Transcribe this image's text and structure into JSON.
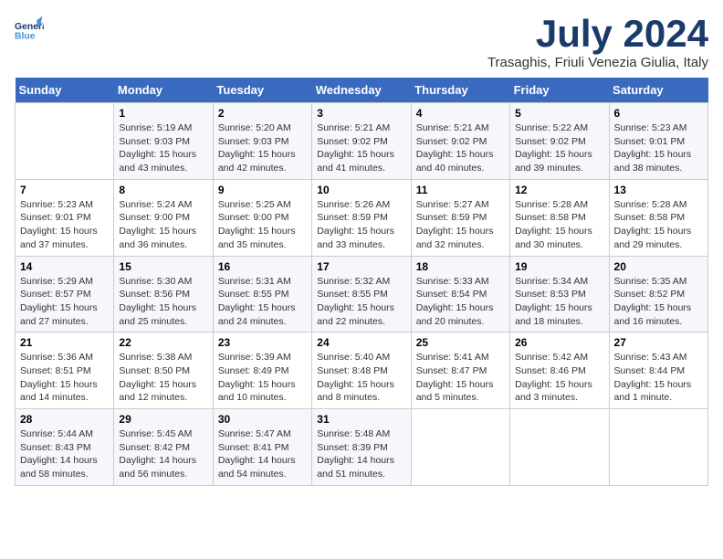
{
  "header": {
    "logo_line1": "General",
    "logo_line2": "Blue",
    "month": "July 2024",
    "location": "Trasaghis, Friuli Venezia Giulia, Italy"
  },
  "days_of_week": [
    "Sunday",
    "Monday",
    "Tuesday",
    "Wednesday",
    "Thursday",
    "Friday",
    "Saturday"
  ],
  "weeks": [
    [
      {
        "day": "",
        "info": ""
      },
      {
        "day": "1",
        "info": "Sunrise: 5:19 AM\nSunset: 9:03 PM\nDaylight: 15 hours\nand 43 minutes."
      },
      {
        "day": "2",
        "info": "Sunrise: 5:20 AM\nSunset: 9:03 PM\nDaylight: 15 hours\nand 42 minutes."
      },
      {
        "day": "3",
        "info": "Sunrise: 5:21 AM\nSunset: 9:02 PM\nDaylight: 15 hours\nand 41 minutes."
      },
      {
        "day": "4",
        "info": "Sunrise: 5:21 AM\nSunset: 9:02 PM\nDaylight: 15 hours\nand 40 minutes."
      },
      {
        "day": "5",
        "info": "Sunrise: 5:22 AM\nSunset: 9:02 PM\nDaylight: 15 hours\nand 39 minutes."
      },
      {
        "day": "6",
        "info": "Sunrise: 5:23 AM\nSunset: 9:01 PM\nDaylight: 15 hours\nand 38 minutes."
      }
    ],
    [
      {
        "day": "7",
        "info": "Sunrise: 5:23 AM\nSunset: 9:01 PM\nDaylight: 15 hours\nand 37 minutes."
      },
      {
        "day": "8",
        "info": "Sunrise: 5:24 AM\nSunset: 9:00 PM\nDaylight: 15 hours\nand 36 minutes."
      },
      {
        "day": "9",
        "info": "Sunrise: 5:25 AM\nSunset: 9:00 PM\nDaylight: 15 hours\nand 35 minutes."
      },
      {
        "day": "10",
        "info": "Sunrise: 5:26 AM\nSunset: 8:59 PM\nDaylight: 15 hours\nand 33 minutes."
      },
      {
        "day": "11",
        "info": "Sunrise: 5:27 AM\nSunset: 8:59 PM\nDaylight: 15 hours\nand 32 minutes."
      },
      {
        "day": "12",
        "info": "Sunrise: 5:28 AM\nSunset: 8:58 PM\nDaylight: 15 hours\nand 30 minutes."
      },
      {
        "day": "13",
        "info": "Sunrise: 5:28 AM\nSunset: 8:58 PM\nDaylight: 15 hours\nand 29 minutes."
      }
    ],
    [
      {
        "day": "14",
        "info": "Sunrise: 5:29 AM\nSunset: 8:57 PM\nDaylight: 15 hours\nand 27 minutes."
      },
      {
        "day": "15",
        "info": "Sunrise: 5:30 AM\nSunset: 8:56 PM\nDaylight: 15 hours\nand 25 minutes."
      },
      {
        "day": "16",
        "info": "Sunrise: 5:31 AM\nSunset: 8:55 PM\nDaylight: 15 hours\nand 24 minutes."
      },
      {
        "day": "17",
        "info": "Sunrise: 5:32 AM\nSunset: 8:55 PM\nDaylight: 15 hours\nand 22 minutes."
      },
      {
        "day": "18",
        "info": "Sunrise: 5:33 AM\nSunset: 8:54 PM\nDaylight: 15 hours\nand 20 minutes."
      },
      {
        "day": "19",
        "info": "Sunrise: 5:34 AM\nSunset: 8:53 PM\nDaylight: 15 hours\nand 18 minutes."
      },
      {
        "day": "20",
        "info": "Sunrise: 5:35 AM\nSunset: 8:52 PM\nDaylight: 15 hours\nand 16 minutes."
      }
    ],
    [
      {
        "day": "21",
        "info": "Sunrise: 5:36 AM\nSunset: 8:51 PM\nDaylight: 15 hours\nand 14 minutes."
      },
      {
        "day": "22",
        "info": "Sunrise: 5:38 AM\nSunset: 8:50 PM\nDaylight: 15 hours\nand 12 minutes."
      },
      {
        "day": "23",
        "info": "Sunrise: 5:39 AM\nSunset: 8:49 PM\nDaylight: 15 hours\nand 10 minutes."
      },
      {
        "day": "24",
        "info": "Sunrise: 5:40 AM\nSunset: 8:48 PM\nDaylight: 15 hours\nand 8 minutes."
      },
      {
        "day": "25",
        "info": "Sunrise: 5:41 AM\nSunset: 8:47 PM\nDaylight: 15 hours\nand 5 minutes."
      },
      {
        "day": "26",
        "info": "Sunrise: 5:42 AM\nSunset: 8:46 PM\nDaylight: 15 hours\nand 3 minutes."
      },
      {
        "day": "27",
        "info": "Sunrise: 5:43 AM\nSunset: 8:44 PM\nDaylight: 15 hours\nand 1 minute."
      }
    ],
    [
      {
        "day": "28",
        "info": "Sunrise: 5:44 AM\nSunset: 8:43 PM\nDaylight: 14 hours\nand 58 minutes."
      },
      {
        "day": "29",
        "info": "Sunrise: 5:45 AM\nSunset: 8:42 PM\nDaylight: 14 hours\nand 56 minutes."
      },
      {
        "day": "30",
        "info": "Sunrise: 5:47 AM\nSunset: 8:41 PM\nDaylight: 14 hours\nand 54 minutes."
      },
      {
        "day": "31",
        "info": "Sunrise: 5:48 AM\nSunset: 8:39 PM\nDaylight: 14 hours\nand 51 minutes."
      },
      {
        "day": "",
        "info": ""
      },
      {
        "day": "",
        "info": ""
      },
      {
        "day": "",
        "info": ""
      }
    ]
  ]
}
